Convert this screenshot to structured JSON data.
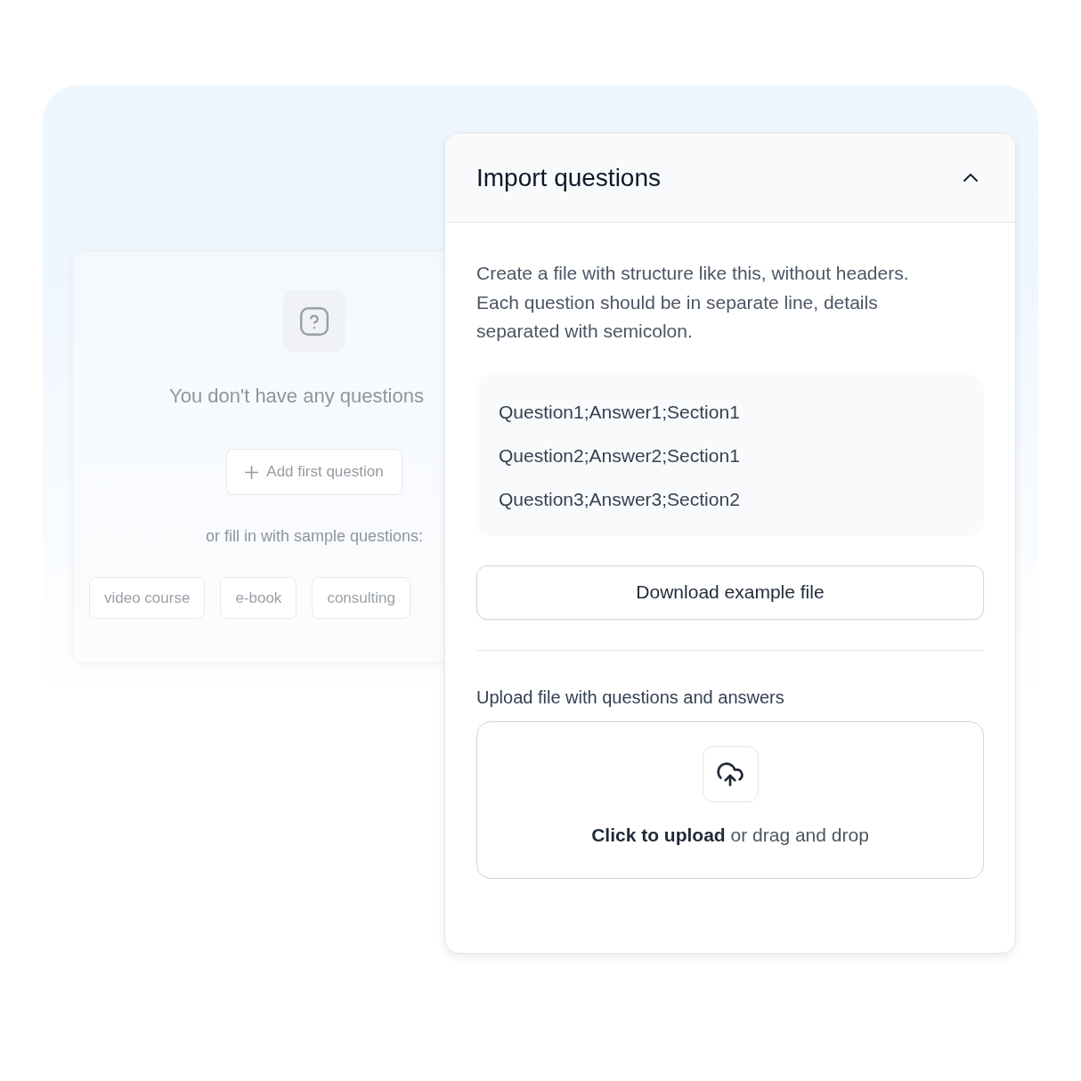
{
  "empty_state": {
    "message": "You don't have any questions",
    "add_button": "Add first question",
    "samples_prompt": "or fill in with sample questions:",
    "sample_chips": [
      "video course",
      "e-book",
      "consulting"
    ]
  },
  "import_panel": {
    "title": "Import questions",
    "expanded": true,
    "description": "Create a file with structure like this, without headers. Each question should be in separate line, details separated with semicolon.",
    "example_lines": [
      "Question1;Answer1;Section1",
      "Question2;Answer2;Section1",
      "Question3;Answer3;Section2"
    ],
    "download_button": "Download example file",
    "upload_label": "Upload file with questions and answers",
    "dropzone_text": "**Click to upload** or drag and drop"
  }
}
